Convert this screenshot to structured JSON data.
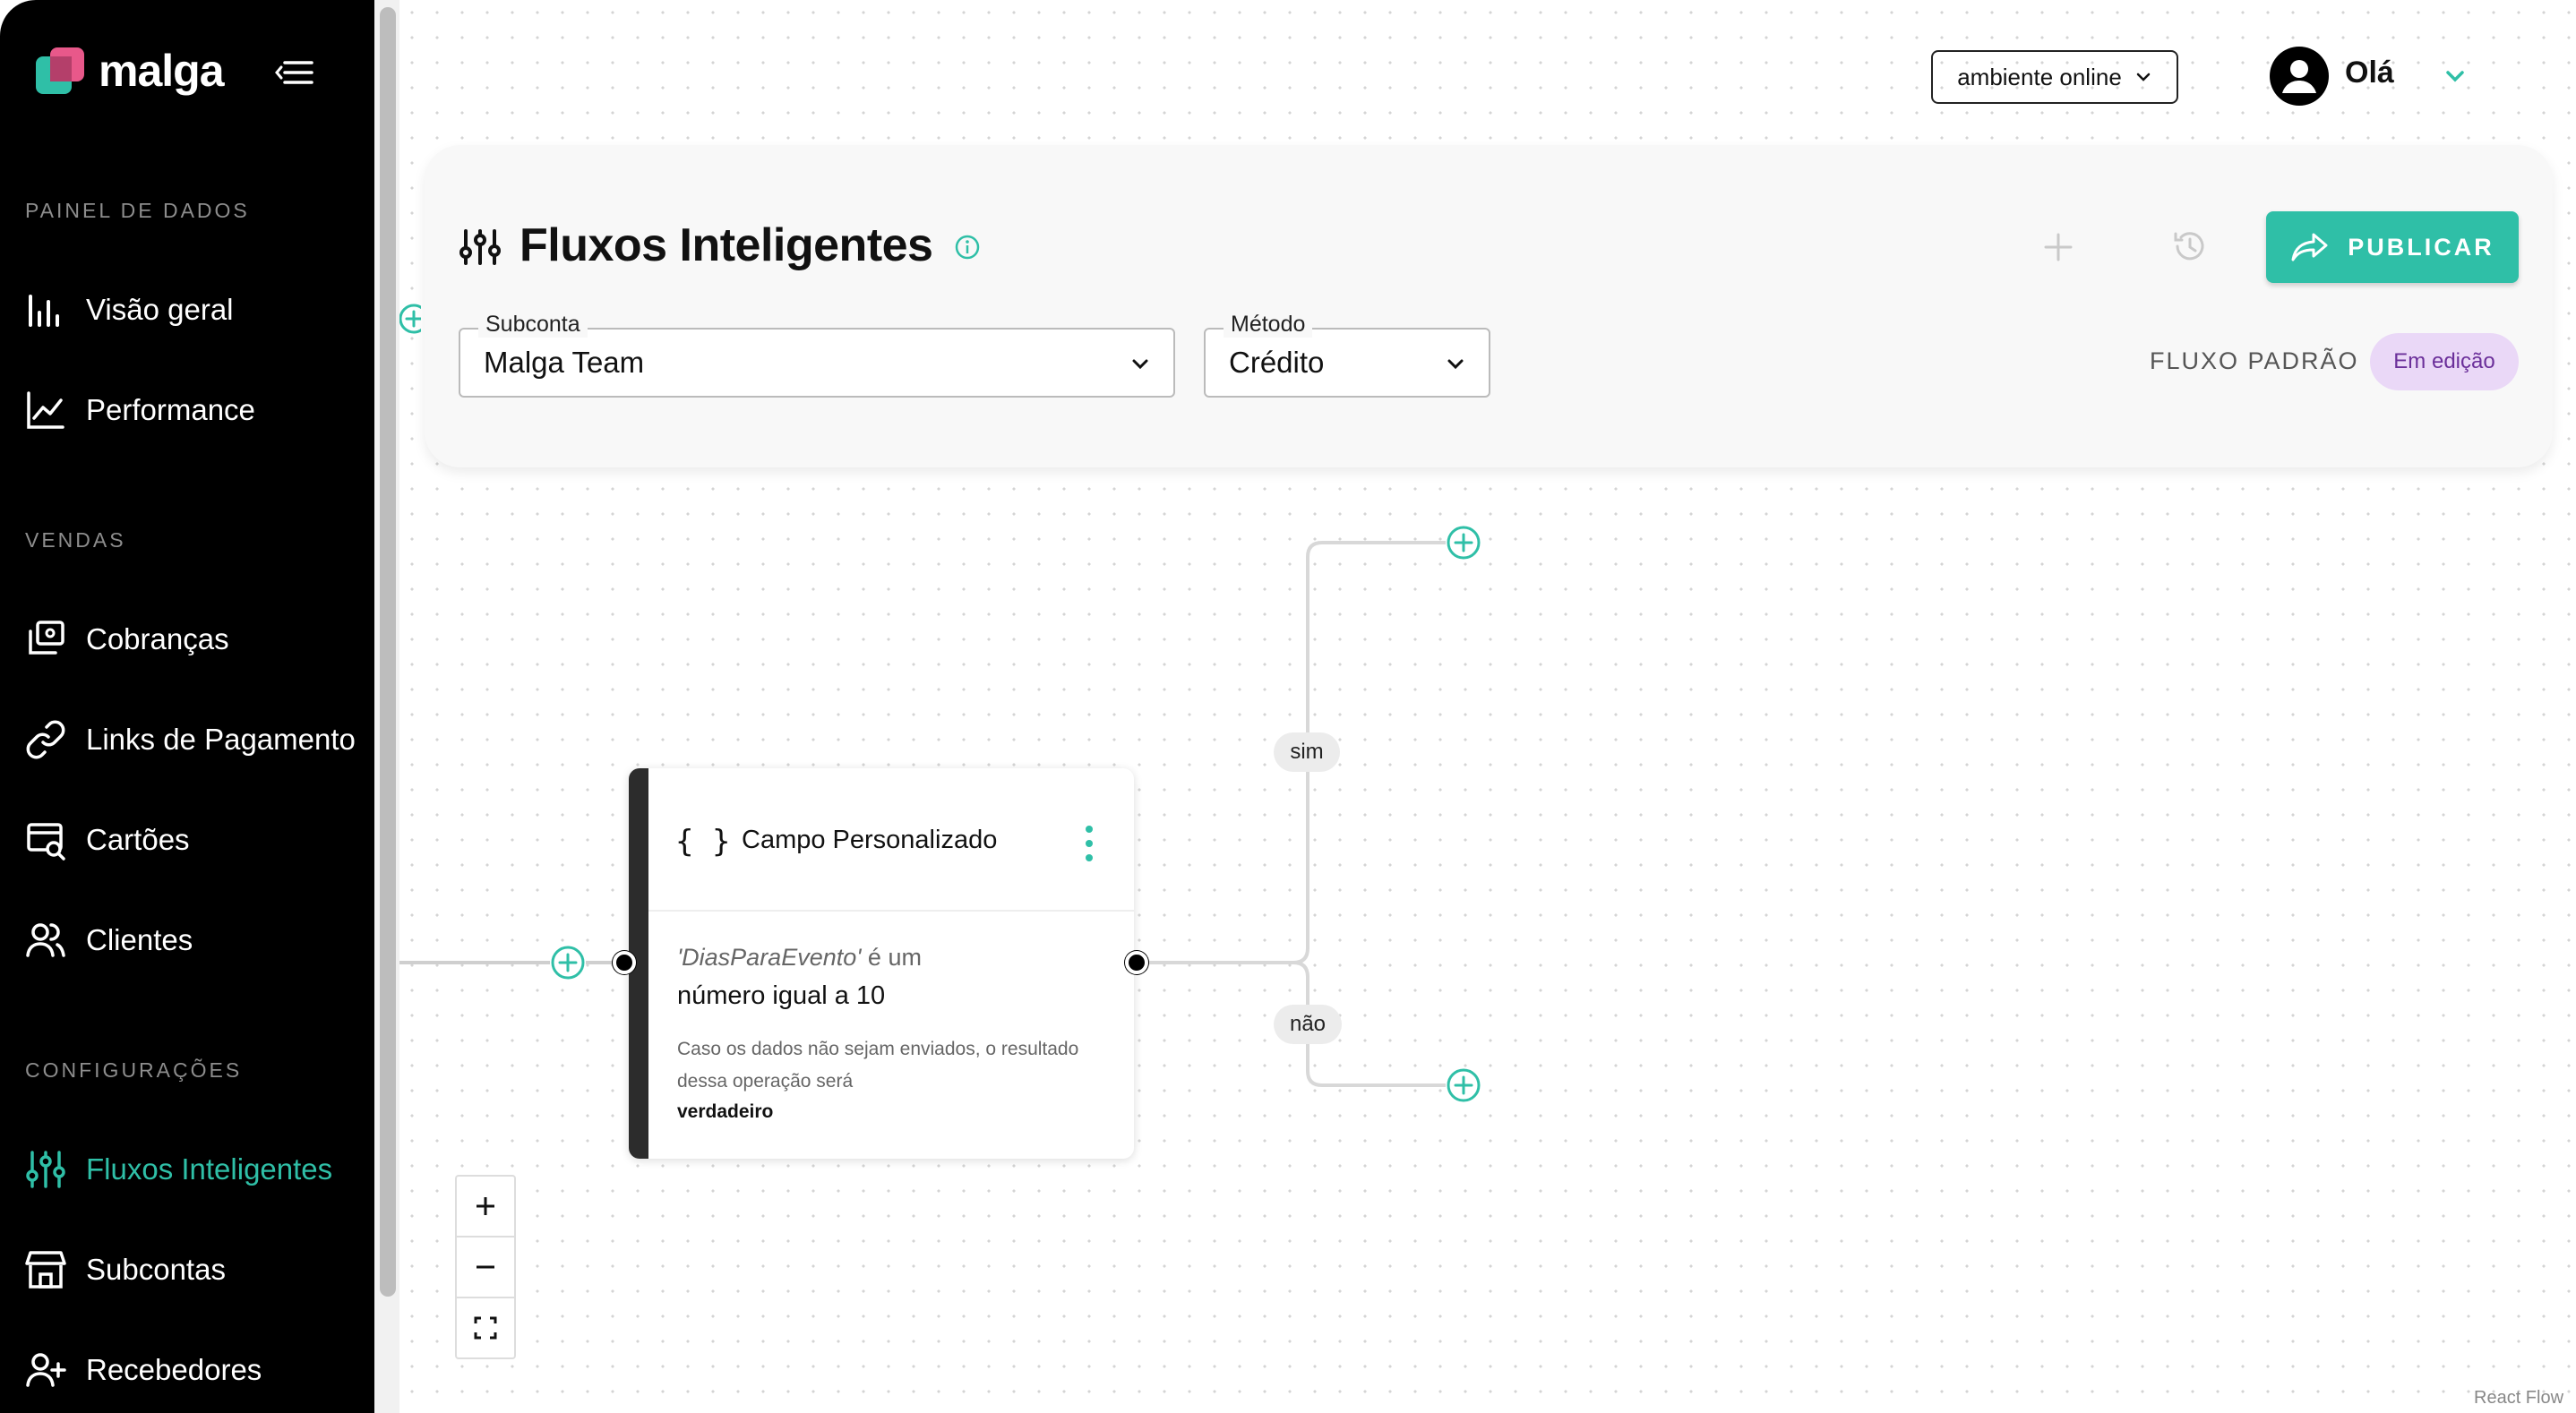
{
  "brand": {
    "name": "malga",
    "colors": {
      "accent": "#2fbfa7",
      "logo_pink": "#e8588a",
      "badge_bg": "#ead8f7",
      "badge_text": "#6b2f9a"
    }
  },
  "sidebar": {
    "menu_icon": "menu-collapse-icon",
    "sections": [
      {
        "label": "PAINEL DE DADOS",
        "items": [
          {
            "label": "Visão geral",
            "icon": "bar-chart-icon"
          },
          {
            "label": "Performance",
            "icon": "line-chart-icon"
          }
        ]
      },
      {
        "label": "VENDAS",
        "items": [
          {
            "label": "Cobranças",
            "icon": "charges-icon"
          },
          {
            "label": "Links de Pagamento",
            "icon": "link-icon"
          },
          {
            "label": "Cartões",
            "icon": "card-search-icon"
          },
          {
            "label": "Clientes",
            "icon": "users-icon"
          }
        ]
      },
      {
        "label": "CONFIGURAÇÕES",
        "items": [
          {
            "label": "Fluxos Inteligentes",
            "icon": "sliders-icon",
            "active": true
          },
          {
            "label": "Subcontas",
            "icon": "store-icon"
          },
          {
            "label": "Recebedores",
            "icon": "user-plus-icon"
          }
        ]
      }
    ]
  },
  "topbar": {
    "environment": "ambiente online",
    "greeting": "Olá"
  },
  "header": {
    "title": "Fluxos Inteligentes",
    "publish_label": "PUBLICAR",
    "subconta": {
      "label": "Subconta",
      "value": "Malga Team"
    },
    "metodo": {
      "label": "Método",
      "value": "Crédito"
    },
    "flow_type": "FLUXO PADRÃO",
    "status": "Em edição"
  },
  "flow": {
    "node": {
      "icon": "{ }",
      "title": "Campo Personalizado",
      "condition_var": "'DiasParaEvento'",
      "condition_op": " é um",
      "condition_value": "número igual a 10",
      "fallback_note": "Caso os dados não sejam enviados, o resultado dessa operação será",
      "fallback_value": "verdadeiro"
    },
    "branch_yes": "sim",
    "branch_no": "não"
  },
  "canvas": {
    "attribution": "React Flow"
  }
}
